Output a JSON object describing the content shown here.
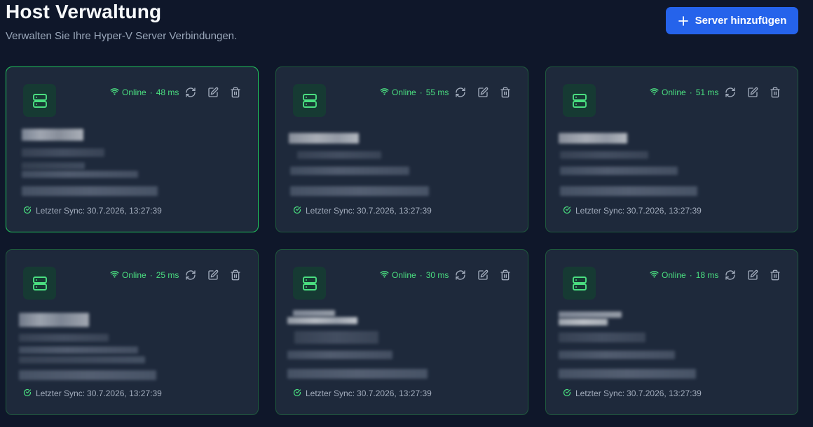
{
  "header": {
    "title": "Host Verwaltung",
    "subtitle": "Verwalten Sie Ihre Hyper-V Server Verbindungen.",
    "add_button_label": "Server hinzufügen"
  },
  "colors": {
    "background": "#0f172a",
    "card": "#1e293b",
    "accent": "#2563eb",
    "online": "#4ade80",
    "card_border": "#1f5a3d",
    "card_border_active": "#22c55e"
  },
  "icons": {
    "add": "plus-icon",
    "server": "server-icon",
    "status": "wifi-icon",
    "refresh": "refresh-icon",
    "edit": "edit-icon",
    "delete": "trash-icon",
    "sync": "check-circle-icon"
  },
  "hosts": [
    {
      "status": "Online",
      "sep": "·",
      "latency": "48 ms",
      "sync_label": "Letzter Sync:",
      "sync_time": "30.7.2026, 13:27:39",
      "active": true
    },
    {
      "status": "Online",
      "sep": "·",
      "latency": "55 ms",
      "sync_label": "Letzter Sync:",
      "sync_time": "30.7.2026, 13:27:39",
      "active": false
    },
    {
      "status": "Online",
      "sep": "·",
      "latency": "51 ms",
      "sync_label": "Letzter Sync:",
      "sync_time": "30.7.2026, 13:27:39",
      "active": false
    },
    {
      "status": "Online",
      "sep": "·",
      "latency": "25 ms",
      "sync_label": "Letzter Sync:",
      "sync_time": "30.7.2026, 13:27:39",
      "active": false
    },
    {
      "status": "Online",
      "sep": "·",
      "latency": "30 ms",
      "sync_label": "Letzter Sync:",
      "sync_time": "30.7.2026, 13:27:39",
      "active": false
    },
    {
      "status": "Online",
      "sep": "·",
      "latency": "18 ms",
      "sync_label": "Letzter Sync:",
      "sync_time": "30.7.2026, 13:27:39",
      "active": false
    }
  ]
}
